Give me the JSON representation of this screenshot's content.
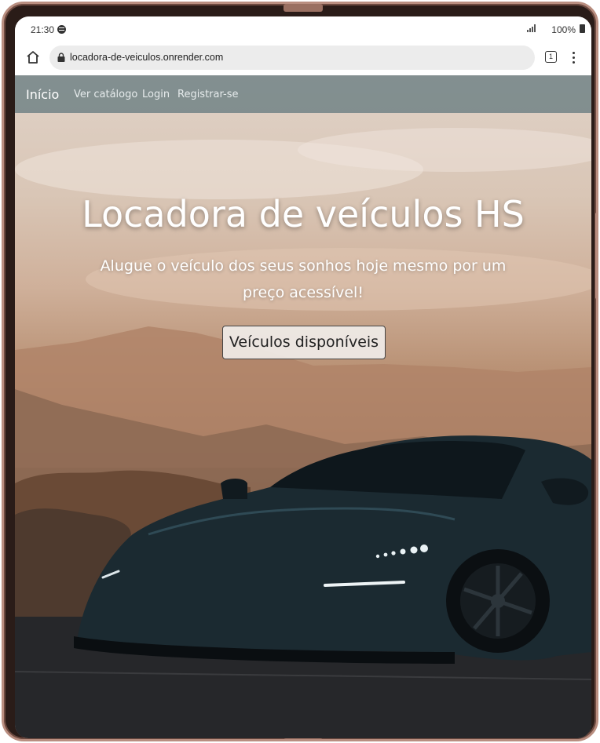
{
  "status_bar": {
    "time": "21:30",
    "battery": "100%"
  },
  "browser": {
    "url": "locadora-de-veiculos.onrender.com",
    "tab_count": "1"
  },
  "nav": {
    "brand": "Início",
    "links": [
      "Ver catálogo",
      "Login",
      "Registrar-se"
    ]
  },
  "hero": {
    "title": "Locadora de veículos HS",
    "subtitle": "Alugue o veículo dos seus sonhos hoje mesmo por um preço acessível!",
    "button": "Veículos disponíveis"
  },
  "colors": {
    "navbar": "#6e8084",
    "accent_light": "#ffffff"
  }
}
